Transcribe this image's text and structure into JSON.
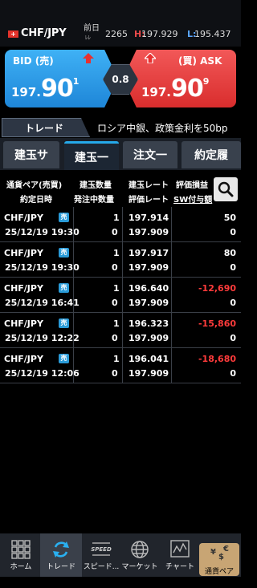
{
  "header": {
    "pair": "CHF/JPY",
    "prev_day_label": "前日",
    "prev_day_arrow": "ﾚﾚ",
    "count": "2265",
    "high_label": "H:",
    "high_value": "197.929",
    "low_label": "L:",
    "low_value": "195.437"
  },
  "quote": {
    "bid_label": "BID (売)",
    "ask_label": "(買) ASK",
    "bid_small": "197.",
    "bid_big": "90",
    "bid_pip": "1",
    "ask_small": "197.",
    "ask_big": "90",
    "ask_pip": "9",
    "spread": "0.8"
  },
  "trade_tab": "トレード",
  "news_ticker": "ロシア中銀、政策金利を50bp",
  "tabs": [
    {
      "label": "建玉サ",
      "active": false
    },
    {
      "label": "建玉一",
      "active": true
    },
    {
      "label": "注文一",
      "active": false
    },
    {
      "label": "約定履",
      "active": false
    }
  ],
  "table": {
    "headers": {
      "pair_side": "通貨ペア(売買)",
      "trade_date": "約定日時",
      "position_qty": "建玉数量",
      "pending_qty": "発注中数量",
      "position_rate": "建玉レート",
      "valuation_rate": "評価レート",
      "pnl": "評価損益",
      "swap": "SW付与額"
    },
    "rows": [
      {
        "pair": "CHF/JPY",
        "side": "売",
        "date": "25/12/19 19:30",
        "qty": "1",
        "pending": "0",
        "rate": "197.914",
        "eval_rate": "197.909",
        "pnl": "50",
        "swap": "0",
        "negative": false
      },
      {
        "pair": "CHF/JPY",
        "side": "売",
        "date": "25/12/19 19:30",
        "qty": "1",
        "pending": "0",
        "rate": "197.917",
        "eval_rate": "197.909",
        "pnl": "80",
        "swap": "0",
        "negative": false
      },
      {
        "pair": "CHF/JPY",
        "side": "売",
        "date": "25/12/19 16:41",
        "qty": "1",
        "pending": "0",
        "rate": "196.640",
        "eval_rate": "197.909",
        "pnl": "-12,690",
        "swap": "0",
        "negative": true
      },
      {
        "pair": "CHF/JPY",
        "side": "売",
        "date": "25/12/19 12:22",
        "qty": "1",
        "pending": "0",
        "rate": "196.323",
        "eval_rate": "197.909",
        "pnl": "-15,860",
        "swap": "0",
        "negative": true
      },
      {
        "pair": "CHF/JPY",
        "side": "売",
        "date": "25/12/19 12:06",
        "qty": "1",
        "pending": "0",
        "rate": "196.041",
        "eval_rate": "197.909",
        "pnl": "-18,680",
        "swap": "0",
        "negative": true
      }
    ]
  },
  "nav": {
    "home": "ホーム",
    "trade": "トレード",
    "speed": "スピード...",
    "market": "マーケット",
    "chart": "チャート",
    "pair": "通貨ペア",
    "speed_icon_text": "SPEED"
  },
  "colors": {
    "bid": "#2a9be4",
    "ask": "#e84040",
    "accent": "#25a9e9",
    "negative": "#ff3b3b"
  }
}
